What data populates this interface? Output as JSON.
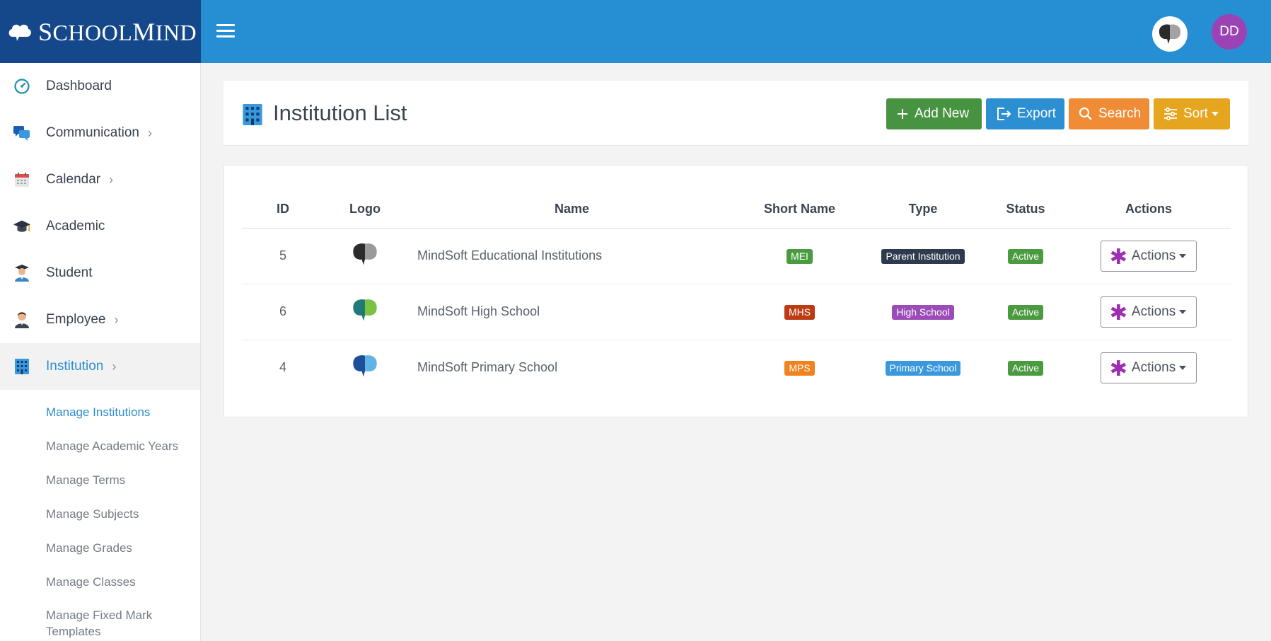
{
  "brand": {
    "text_first": "S",
    "text_rest": "CHOOL",
    "text_second_first": "M",
    "text_second_rest": "IND"
  },
  "header": {
    "avatar_initials": "DD"
  },
  "sidebar": {
    "items": [
      {
        "label": "Dashboard",
        "icon": "dashboard-gauge-icon"
      },
      {
        "label": "Communication",
        "icon": "chat-bubbles-icon"
      },
      {
        "label": "Calendar",
        "icon": "calendar-icon"
      },
      {
        "label": "Academic",
        "icon": "graduation-cap-icon"
      },
      {
        "label": "Student",
        "icon": "student-icon"
      },
      {
        "label": "Employee",
        "icon": "employee-icon"
      },
      {
        "label": "Institution",
        "icon": "building-icon"
      }
    ],
    "subitems": [
      "Manage Institutions",
      "Manage Academic Years",
      "Manage Terms",
      "Manage Subjects",
      "Manage Grades",
      "Manage Classes",
      "Manage Fixed Mark Templates"
    ]
  },
  "page": {
    "title": "Institution List",
    "buttons": {
      "add_new": "Add New",
      "export": "Export",
      "search": "Search",
      "sort": "Sort"
    }
  },
  "table": {
    "headers": [
      "ID",
      "Logo",
      "Name",
      "Short Name",
      "Type",
      "Status",
      "Actions"
    ],
    "rows": [
      {
        "id": "5",
        "name": "MindSoft Educational Institutions",
        "short": "MEI",
        "short_color": "#4a9b3f",
        "type": "Parent Institution",
        "type_color": "#2e3a4e",
        "status": "Active",
        "actions": "Actions",
        "logo_colors": [
          "#2b2b2b",
          "#9a9a9a"
        ]
      },
      {
        "id": "6",
        "name": "MindSoft High School",
        "short": "MHS",
        "short_color": "#bd3a12",
        "type": "High School",
        "type_color": "#9b4cb8",
        "status": "Active",
        "actions": "Actions",
        "logo_colors": [
          "#1f7a78",
          "#7cc243"
        ]
      },
      {
        "id": "4",
        "name": "MindSoft Primary School",
        "short": "MPS",
        "short_color": "#f0821f",
        "type": "Primary School",
        "type_color": "#3a98dc",
        "status": "Active",
        "actions": "Actions",
        "logo_colors": [
          "#1d4f9a",
          "#5fb3e8"
        ]
      }
    ],
    "status_color": "#4a9b3f"
  },
  "colors": {
    "brand_bg": "#15488a",
    "topbar_bg": "#268fd3",
    "accent": "#2e8ed0"
  }
}
